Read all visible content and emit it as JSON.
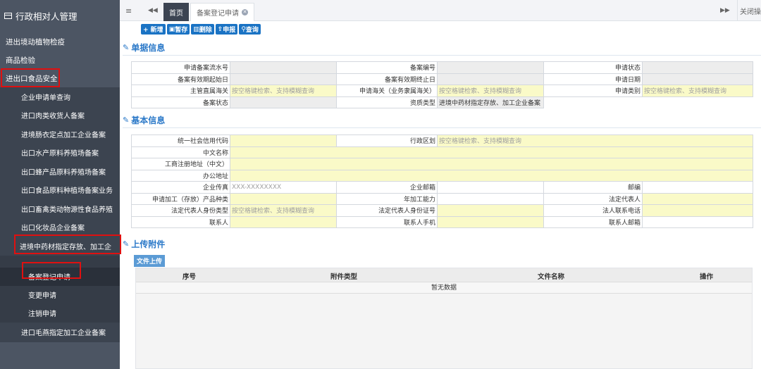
{
  "sidebar": {
    "title": "行政相对人管理",
    "items": [
      "进出境动植物检疫",
      "商品检验",
      "进出口食品安全"
    ],
    "subitems": [
      "企业申请单查询",
      "进口肉类收货人备案",
      "进境肠衣定点加工企业备案",
      "出口水产原料养殖场备案",
      "出口蜂产品原料养殖场备案",
      "出口食品原料种植场备案业务",
      "出口畜禽类动物源性食品养殖",
      "出口化妆品企业备案",
      "进境中药材指定存放、加工企"
    ],
    "sub2": [
      "备案登记申请",
      "变更申请",
      "注销申请"
    ],
    "last": "进口毛燕指定加工企业备案"
  },
  "topbar": {
    "menu_icon": "≡",
    "back_icon": "◀◀",
    "home": "首页",
    "current_tab": "备案登记申请",
    "close_x": "✕",
    "forward_icon": "▶▶",
    "close_op": "关闭操"
  },
  "toolbar": {
    "new": "+ 新增",
    "save": "暂存",
    "delete": "删除",
    "submit": "申报",
    "query": "查询"
  },
  "sections": {
    "doc": "单据信息",
    "basic": "基本信息",
    "upload": "上传附件"
  },
  "doc_info": {
    "serial": "申请备案流水号",
    "record_no": "备案编号",
    "status": "申请状态",
    "valid_start": "备案有效期起始日",
    "valid_end": "备案有效期终止日",
    "apply_date": "申请日期",
    "customs": "主管直属海关",
    "customs_ph": "按空格键检索、支持模糊查询",
    "apply_customs": "申请海关（业务隶属海关）",
    "apply_customs_ph": "按空格键检索、支持模糊查询",
    "apply_type": "申请类别",
    "apply_type_ph": "按空格键检索、支持模糊查询",
    "record_status": "备案状态",
    "res_type": "资质类型",
    "res_type_val": "进境中药材指定存放、加工企业备案"
  },
  "basic_info": {
    "credit_code": "统一社会信用代码",
    "region": "行政区划",
    "region_ph": "按空格键检索、支持模糊查询",
    "cn_name": "中文名称",
    "reg_addr": "工商注册地址（中文）",
    "office_addr": "办公地址",
    "fax": "企业传真",
    "fax_ph": "XXX-XXXXXXXX",
    "email": "企业邮箱",
    "postcode": "邮编",
    "product": "申请加工（存放）产品种类",
    "capacity": "年加工能力",
    "legal_rep": "法定代表人",
    "id_type": "法定代表人身份类型",
    "id_type_ph": "按空格键检索、支持模糊查询",
    "id_no": "法定代表人身份证号",
    "rep_phone": "法人联系电话",
    "contact": "联系人",
    "contact_phone": "联系人手机",
    "contact_email": "联系人邮箱"
  },
  "upload": {
    "button": "文件上传",
    "cols": [
      "序号",
      "附件类型",
      "文件名称",
      "操作"
    ],
    "empty": "暂无数据"
  }
}
